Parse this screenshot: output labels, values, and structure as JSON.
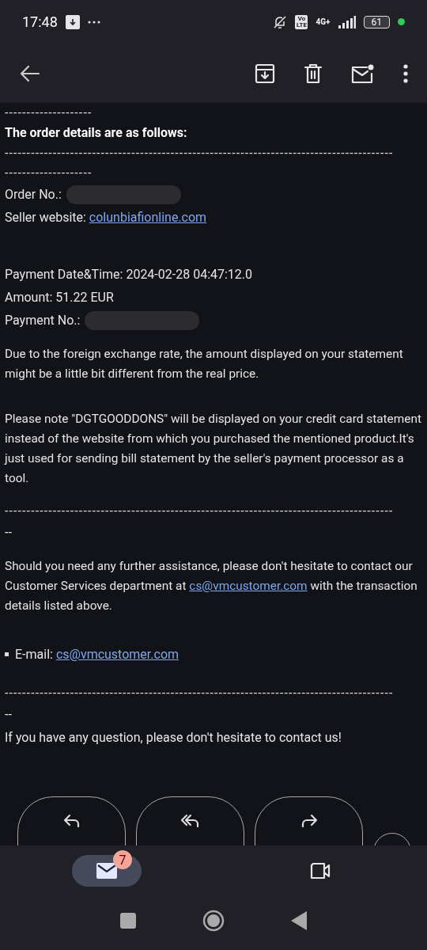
{
  "status_bar": {
    "time": "17:48",
    "volte": "Vo LTE",
    "network": "4G+",
    "battery": "61"
  },
  "blocks": [
    {
      "kind": "dashes",
      "text": "--------------------"
    },
    {
      "kind": "heading",
      "text": "The order details are as follows:"
    },
    {
      "kind": "dashes",
      "text": "-----------------------------------------------------------------------------------------"
    },
    {
      "kind": "dashes",
      "text": "--------------------"
    },
    {
      "kind": "redacted",
      "text": "Order No.:"
    },
    {
      "kind": "link",
      "text": "Seller website:",
      "link": "colunbiafionline.com"
    },
    {
      "kind": "spacer"
    },
    {
      "kind": "text",
      "text": "Payment Date&Time: 2024-02-28 04:47:12.0"
    },
    {
      "kind": "text",
      "text": "Amount: 51.22 EUR"
    },
    {
      "kind": "redacted",
      "text": "Payment No.:"
    },
    {
      "kind": "paragraph",
      "text": "Due to the foreign exchange rate, the amount displayed on your statement might be a little bit different from the real price."
    },
    {
      "kind": "paragraph",
      "text": "Please note \"DGTGOODDONS\" will be displayed on your credit card statement instead of the website from which you purchased the mentioned product.It's just used for sending bill statement by the seller's payment processor as a tool."
    },
    {
      "kind": "dashes",
      "text": "-----------------------------------------------------------------------------------------"
    },
    {
      "kind": "text",
      "text": "--"
    },
    {
      "kind": "paragraph",
      "text": "Should you need any further assistance, please don't hesitate to contact our Customer Services department at",
      "link": "cs@vmcustomer.com",
      "after": "with the transaction details listed above."
    },
    {
      "kind": "bullet",
      "text": "E-mail:",
      "link": "cs@vmcustomer.com"
    },
    {
      "kind": "dashes",
      "text": "-----------------------------------------------------------------------------------------"
    },
    {
      "kind": "text",
      "text": "--"
    },
    {
      "kind": "text",
      "text": "If you have any question, please don't hesitate to contact us!"
    }
  ],
  "actions": [
    {
      "kind": "reply"
    },
    {
      "kind": "reply-all"
    },
    {
      "kind": "forward"
    }
  ],
  "bottom_nav": [
    {
      "kind": "mail",
      "selected": true,
      "badge": "7"
    },
    {
      "kind": "video",
      "selected": false
    }
  ]
}
